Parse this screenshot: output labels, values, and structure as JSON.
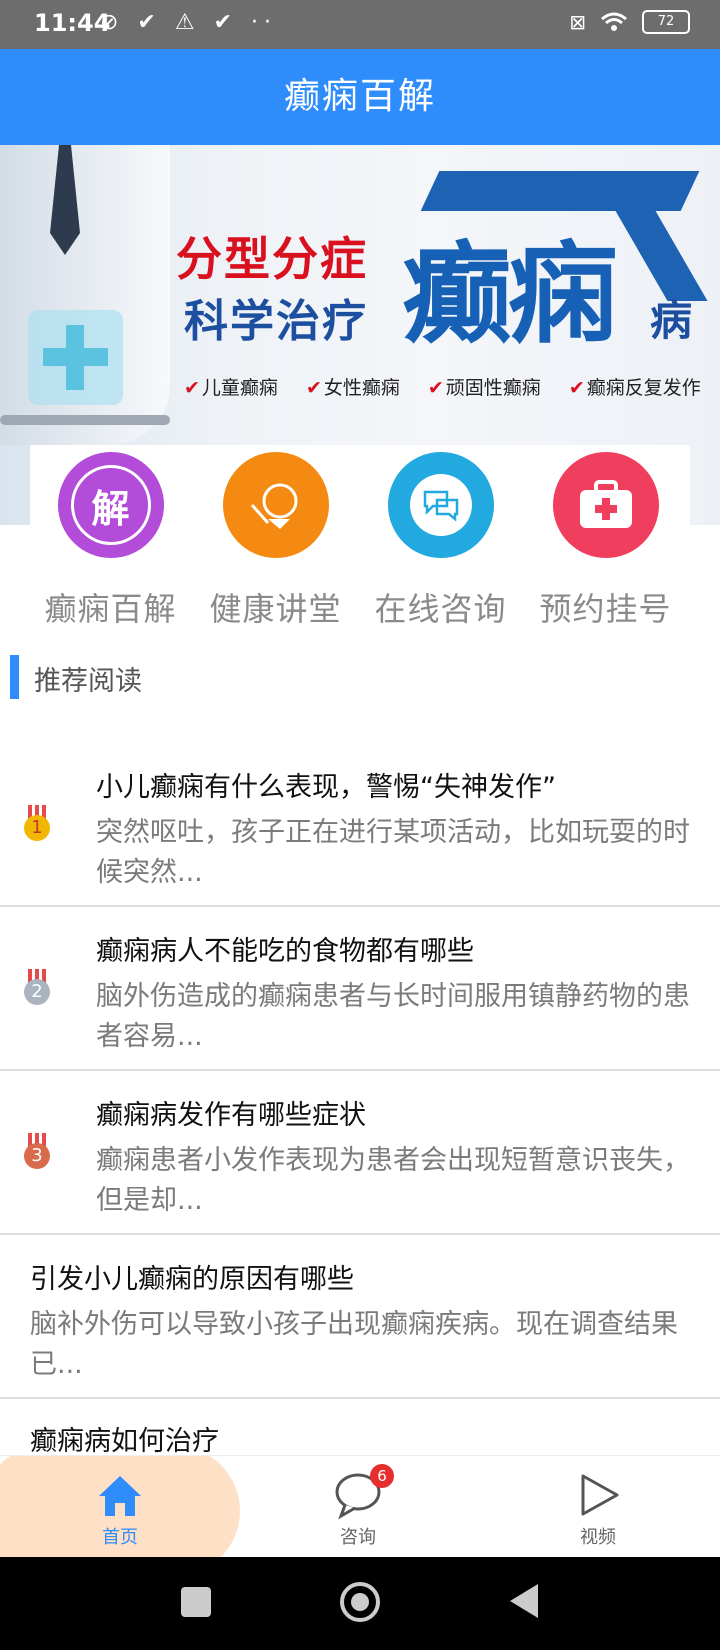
{
  "status_bar": {
    "time": "11:44",
    "icons": "⊘ ✔ ⚠ ✔ ··",
    "battery": "72"
  },
  "header": {
    "title": "癫痫百解"
  },
  "banner": {
    "slogan_line1": "分型分症",
    "slogan_line2": "科学治疗",
    "big_text": "癫痫",
    "big_suffix": "病",
    "tags": [
      "儿童癫痫",
      "女性癫痫",
      "顽固性癫痫",
      "癫痫反复发作"
    ]
  },
  "quick_nav": [
    {
      "label": "癫痫百解",
      "icon": "jie-icon",
      "glyph": "解",
      "color": "#b24cd9"
    },
    {
      "label": "健康讲堂",
      "icon": "lecture-icon",
      "glyph": "",
      "color": "#f58a12"
    },
    {
      "label": "在线咨询",
      "icon": "chat-icon",
      "glyph": "",
      "color": "#22a9e0"
    },
    {
      "label": "预约挂号",
      "icon": "medkit-icon",
      "glyph": "",
      "color": "#f03e5e"
    }
  ],
  "section": {
    "title": "推荐阅读"
  },
  "articles": [
    {
      "rank": "1",
      "rank_color": "#f2b705",
      "title": "小儿癫痫有什么表现，警惕“失神发作”",
      "summary": "突然呕吐，孩子正在进行某项活动，比如玩耍的时候突然..."
    },
    {
      "rank": "2",
      "rank_color": "#a9b4bf",
      "title": "癫痫病人不能吃的食物都有哪些",
      "summary": "脑外伤造成的癫痫患者与长时间服用镇静药物的患者容易..."
    },
    {
      "rank": "3",
      "rank_color": "#d86b4b",
      "title": "癫痫病发作有哪些症状",
      "summary": "癫痫患者小发作表现为患者会出现短暂意识丧失，但是却..."
    },
    {
      "title": "引发小儿癫痫的原因有哪些",
      "summary": "脑补外伤可以导致小孩子出现癫痫疾病。现在调查结果已..."
    },
    {
      "title": "癫痫病如何治疗"
    }
  ],
  "tabbar": {
    "tabs": [
      {
        "label": "首页",
        "icon": "home-icon",
        "active": true,
        "color": "#2f8cfb"
      },
      {
        "label": "咨询",
        "icon": "message-icon",
        "badge": "6",
        "color": "#666666"
      },
      {
        "label": "视频",
        "icon": "play-icon",
        "color": "#666666"
      }
    ]
  }
}
